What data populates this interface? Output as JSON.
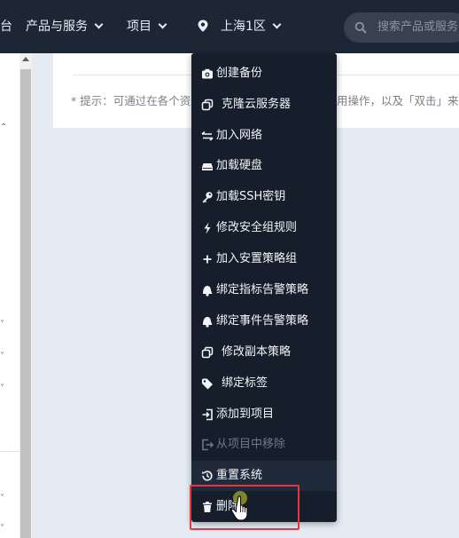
{
  "topbar": {
    "left_fragment": "台",
    "products_label": "产品与服务",
    "projects_label": "项目",
    "region_label": "上海1区",
    "search_placeholder": "搜索产品或服务"
  },
  "hint": {
    "part1": "* 提示：可通过在各个资",
    "part2": "用操作，以及「双击」来"
  },
  "menu": {
    "items": [
      {
        "label": "创建备份",
        "icon": "camera-icon",
        "enabled": true
      },
      {
        "label": "克隆云服务器",
        "icon": "copy-icon",
        "enabled": true
      },
      {
        "label": "加入网络",
        "icon": "network-join-icon",
        "enabled": true
      },
      {
        "label": "加载硬盘",
        "icon": "disk-icon",
        "enabled": true
      },
      {
        "label": "加载SSH密钥",
        "icon": "key-icon",
        "enabled": true
      },
      {
        "label": "修改安全组规则",
        "icon": "lightning-icon",
        "enabled": true
      },
      {
        "label": "加入安置策略组",
        "icon": "plus-icon",
        "enabled": true
      },
      {
        "label": "绑定指标告警策略",
        "icon": "alarm-icon",
        "enabled": true
      },
      {
        "label": "绑定事件告警策略",
        "icon": "alarm-icon",
        "enabled": true
      },
      {
        "label": "修改副本策略",
        "icon": "copy-icon",
        "enabled": true
      },
      {
        "label": "绑定标签",
        "icon": "tag-icon",
        "enabled": true
      },
      {
        "label": "添加到项目",
        "icon": "sign-in-icon",
        "enabled": true
      },
      {
        "label": "从项目中移除",
        "icon": "sign-out-icon",
        "enabled": false
      },
      {
        "label": "重置系统",
        "icon": "history-icon",
        "enabled": true
      },
      {
        "label": "删除",
        "icon": "trash-icon",
        "enabled": true
      }
    ]
  },
  "colors": {
    "topbar": "#1c2635",
    "menu": "#161e2b",
    "content_bg": "#e6ebf3",
    "highlight": "#e8383d",
    "cursor_dot": "#8a8f2c"
  }
}
